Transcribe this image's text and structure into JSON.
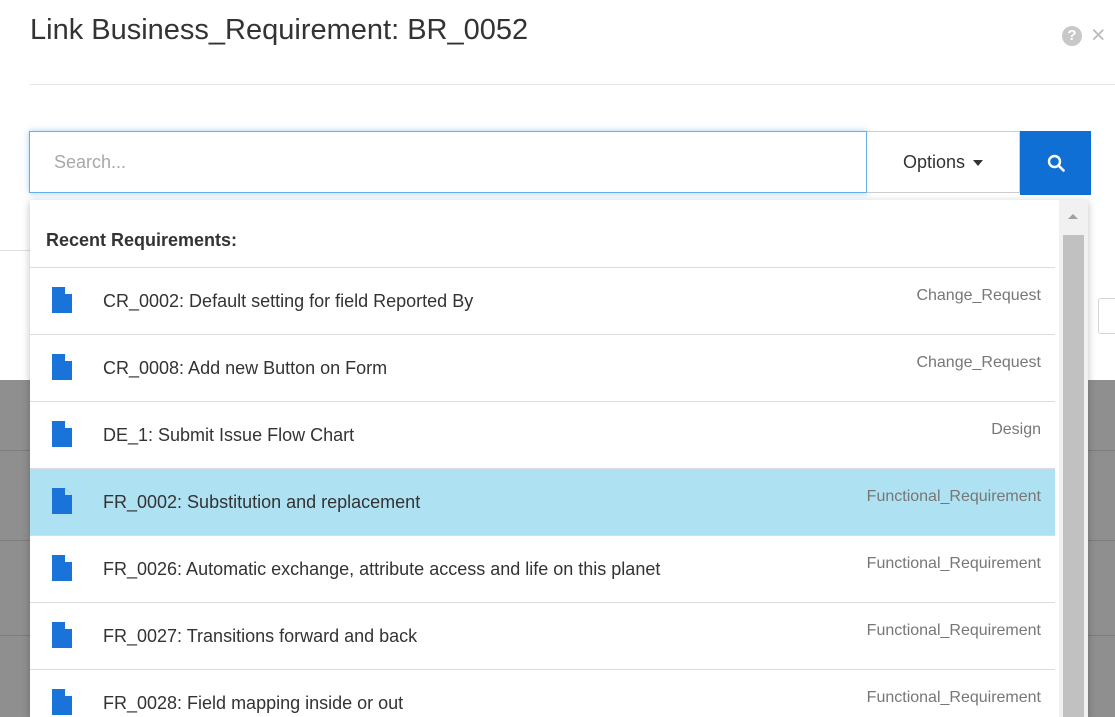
{
  "dialog": {
    "title": "Link Business_Requirement: BR_0052",
    "help_icon": "question-circle-icon",
    "close_glyph": "×"
  },
  "search": {
    "placeholder": "Search...",
    "value": "",
    "options_label": "Options",
    "search_icon": "magnifier-icon",
    "accent_color": "#0f6fd4"
  },
  "dropdown": {
    "header": "Recent Requirements:",
    "selected_color": "#aee1f2",
    "icon_color": "#1a73d9",
    "items": [
      {
        "title": "CR_0002: Default setting for field Reported By",
        "type": "Change_Request",
        "selected": false
      },
      {
        "title": "CR_0008: Add new Button on Form",
        "type": "Change_Request",
        "selected": false
      },
      {
        "title": "DE_1: Submit Issue Flow Chart",
        "type": "Design",
        "selected": false
      },
      {
        "title": "FR_0002: Substitution and replacement",
        "type": "Functional_Requirement",
        "selected": true
      },
      {
        "title": "FR_0026: Automatic exchange, attribute access and life on this planet",
        "type": "Functional_Requirement",
        "selected": false
      },
      {
        "title": "FR_0027: Transitions forward and back",
        "type": "Functional_Requirement",
        "selected": false
      },
      {
        "title": "FR_0028: Field mapping inside or out",
        "type": "Functional_Requirement",
        "selected": false
      }
    ]
  }
}
